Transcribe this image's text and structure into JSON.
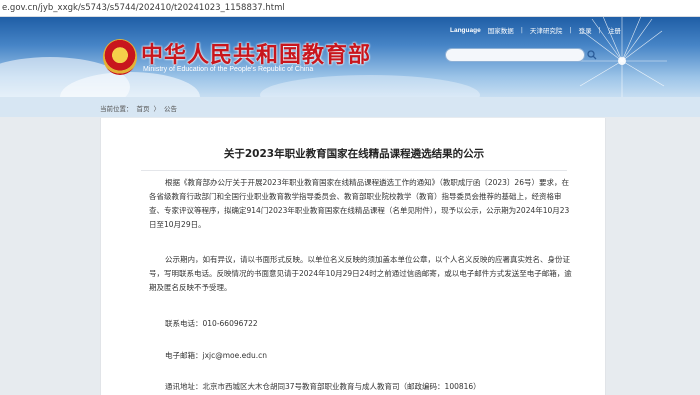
{
  "browser": {
    "url": "e.gov.cn/jyb_xxgk/s5743/s5744/202410/t20241023_1158837.html"
  },
  "header": {
    "site_name": "中华人民共和国教育部",
    "site_name_en": "Ministry of Education of the People's Republic of China",
    "top_nav": {
      "language": "Language",
      "items": [
        "国家数据",
        "天津研究院",
        "登录",
        "注册"
      ]
    },
    "colors": {
      "brand_red": "#c8161d",
      "sky_blue": "#4684c6"
    }
  },
  "breadcrumb": {
    "label": "当前位置：",
    "items": [
      "首页",
      "公告"
    ]
  },
  "article": {
    "title": "关于2023年职业教育国家在线精品课程遴选结果的公示",
    "paragraphs": [
      "根据《教育部办公厅关于开展2023年职业教育国家在线精品课程遴选工作的通知》（教职成厅函〔2023〕26号）要求，在各省级教育行政部门和全国行业职业教育教学指导委员会、教育部职业院校教学（教育）指导委员会推荐的基础上，经资格审查、专家评议等程序，拟确定914门2023年职业教育国家在线精品课程（名单见附件），现予以公示，公示期为2024年10月23日至10月29日。",
      "公示期内，如有异议，请以书面形式反映。以单位名义反映的须加盖本单位公章，以个人名义反映的应署真实姓名、身份证号，写明联系电话。反映情况的书面意见请于2024年10月29日24时之前通过信函邮寄，或以电子邮件方式发送至电子邮箱，逾期及匿名反映不予受理。"
    ],
    "contacts": [
      {
        "label": "联系电话：",
        "value": "010-66096722"
      },
      {
        "label": "电子邮箱：",
        "value": "jxjc@moe.edu.cn"
      },
      {
        "label": "通讯地址：",
        "value": "北京市西城区大木仓胡同37号教育部职业教育与成人教育司（邮政编码：100816）"
      }
    ]
  },
  "icons": {
    "emblem": "national-emblem-icon",
    "search": "search-icon"
  }
}
